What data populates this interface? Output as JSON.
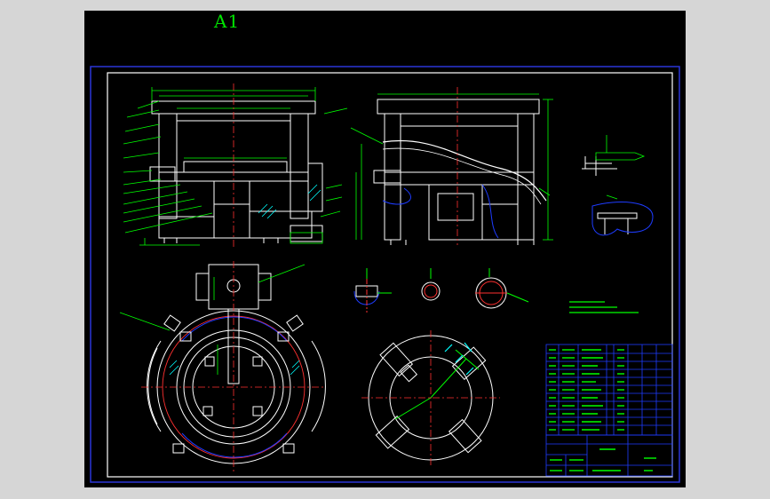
{
  "sheet": {
    "size_label": "A1",
    "colors": {
      "background": "#000000",
      "outer_frame": "#2b35d8",
      "inner_frame": "#ffffff",
      "geometry": "#ffffff",
      "dimension": "#00ff00",
      "centerline": "#ff3030",
      "hidden_edge": "#1e3cff",
      "hatch": "#00ffff",
      "title_block_grid": "#1e3cff",
      "title_block_text": "#00ff00"
    }
  },
  "icons": [
    "section-arrow-icon"
  ]
}
